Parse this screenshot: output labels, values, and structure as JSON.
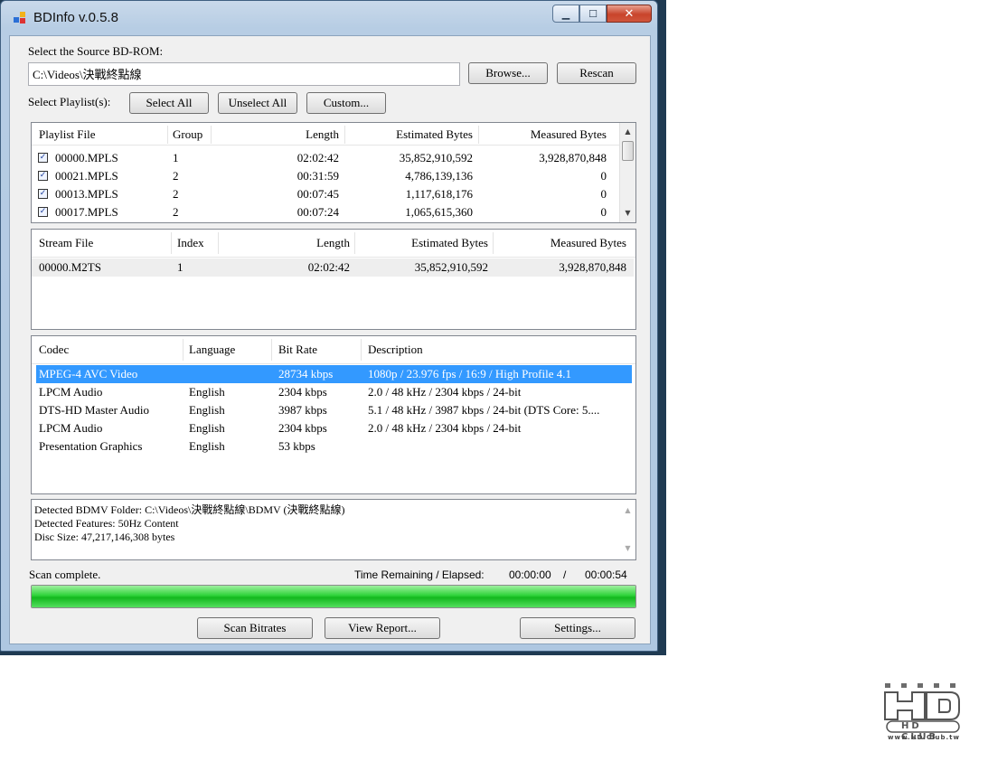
{
  "window": {
    "title": "BDInfo v.0.5.8"
  },
  "source": {
    "label": "Select the Source BD-ROM:",
    "path": "C:\\Videos\\決戰終點線",
    "browse_label": "Browse...",
    "rescan_label": "Rescan"
  },
  "playlists": {
    "label": "Select Playlist(s):",
    "select_all": "Select All",
    "unselect_all": "Unselect All",
    "custom": "Custom...",
    "columns": [
      "Playlist File",
      "Group",
      "Length",
      "Estimated Bytes",
      "Measured Bytes"
    ],
    "rows": [
      {
        "file": "00000.MPLS",
        "group": "1",
        "length": "02:02:42",
        "estimated": "35,852,910,592",
        "measured": "3,928,870,848",
        "checked": true
      },
      {
        "file": "00021.MPLS",
        "group": "2",
        "length": "00:31:59",
        "estimated": "4,786,139,136",
        "measured": "0",
        "checked": true
      },
      {
        "file": "00013.MPLS",
        "group": "2",
        "length": "00:07:45",
        "estimated": "1,117,618,176",
        "measured": "0",
        "checked": true
      },
      {
        "file": "00017.MPLS",
        "group": "2",
        "length": "00:07:24",
        "estimated": "1,065,615,360",
        "measured": "0",
        "checked": true
      }
    ]
  },
  "streams": {
    "columns": [
      "Stream File",
      "Index",
      "Length",
      "Estimated Bytes",
      "Measured Bytes"
    ],
    "rows": [
      {
        "file": "00000.M2TS",
        "index": "1",
        "length": "02:02:42",
        "estimated": "35,852,910,592",
        "measured": "3,928,870,848"
      }
    ]
  },
  "codecs": {
    "columns": [
      "Codec",
      "Language",
      "Bit Rate",
      "Description"
    ],
    "rows": [
      {
        "codec": "MPEG-4 AVC Video",
        "language": "",
        "bitrate": "28734 kbps",
        "description": "1080p / 23.976 fps / 16:9 / High Profile 4.1",
        "selected": true
      },
      {
        "codec": "LPCM Audio",
        "language": "English",
        "bitrate": "2304 kbps",
        "description": "2.0 / 48 kHz / 2304 kbps / 24-bit"
      },
      {
        "codec": "DTS-HD Master Audio",
        "language": "English",
        "bitrate": "3987 kbps",
        "description": "5.1 / 48 kHz / 3987 kbps / 24-bit (DTS Core: 5...."
      },
      {
        "codec": "LPCM Audio",
        "language": "English",
        "bitrate": "2304 kbps",
        "description": "2.0 / 48 kHz / 2304 kbps / 24-bit"
      },
      {
        "codec": "Presentation Graphics",
        "language": "English",
        "bitrate": "53 kbps",
        "description": ""
      }
    ]
  },
  "info_lines": [
    "Detected BDMV Folder: C:\\Videos\\決戰終點線\\BDMV (決戰終點線)",
    "Detected Features: 50Hz Content",
    "Disc Size: 47,217,146,308 bytes"
  ],
  "status": {
    "text": "Scan complete.",
    "time_label": "Time Remaining / Elapsed:",
    "remaining": "00:00:00",
    "separator": "/",
    "elapsed": "00:00:54",
    "progress": 1.0
  },
  "buttons": {
    "scan_bitrates": "Scan Bitrates",
    "view_report": "View Report...",
    "settings": "Settings..."
  },
  "logo": {
    "text": "HD CLUB",
    "url_text": "www.HD.Club.tw"
  },
  "colors": {
    "selection": "#3399ff",
    "progress": "#22c92e"
  }
}
